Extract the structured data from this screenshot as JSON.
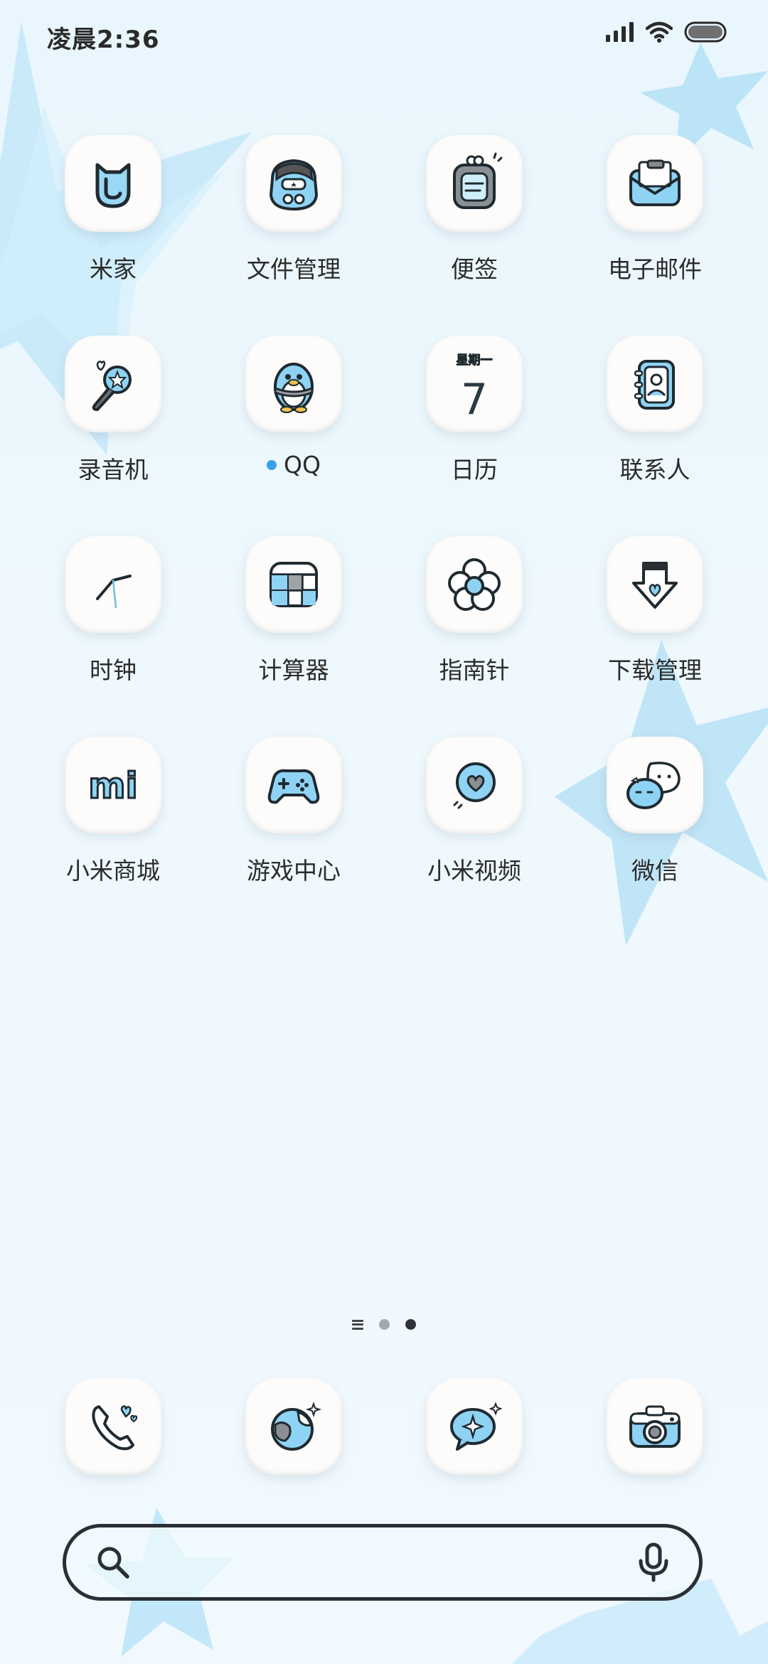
{
  "status_bar": {
    "time": "凌晨2:36"
  },
  "apps": [
    {
      "label": "米家",
      "icon": "mijia-icon"
    },
    {
      "label": "文件管理",
      "icon": "file-manager-icon"
    },
    {
      "label": "便签",
      "icon": "notes-icon"
    },
    {
      "label": "电子邮件",
      "icon": "email-icon"
    },
    {
      "label": "录音机",
      "icon": "recorder-icon"
    },
    {
      "label": "QQ",
      "icon": "qq-penguin-icon",
      "badge_dot": true
    },
    {
      "label": "日历",
      "icon": "calendar-icon",
      "weekday": "星期一",
      "day": "7"
    },
    {
      "label": "联系人",
      "icon": "contacts-icon"
    },
    {
      "label": "时钟",
      "icon": "clock-icon"
    },
    {
      "label": "计算器",
      "icon": "calculator-icon"
    },
    {
      "label": "指南针",
      "icon": "compass-flower-icon"
    },
    {
      "label": "下载管理",
      "icon": "download-icon"
    },
    {
      "label": "小米商城",
      "icon": "mi-store-icon",
      "logo_text": "mi"
    },
    {
      "label": "游戏中心",
      "icon": "gamepad-icon"
    },
    {
      "label": "小米视频",
      "icon": "video-icon"
    },
    {
      "label": "微信",
      "icon": "wechat-icon"
    }
  ],
  "page_indicator": {
    "pages": 2,
    "active_index": 1
  },
  "dock": [
    {
      "icon": "phone-icon"
    },
    {
      "icon": "browser-globe-icon"
    },
    {
      "icon": "messages-icon"
    },
    {
      "icon": "camera-icon"
    }
  ],
  "colors": {
    "accent": "#8fd3f4",
    "outline": "#1f2a30",
    "badge": "#3aa0e8"
  }
}
